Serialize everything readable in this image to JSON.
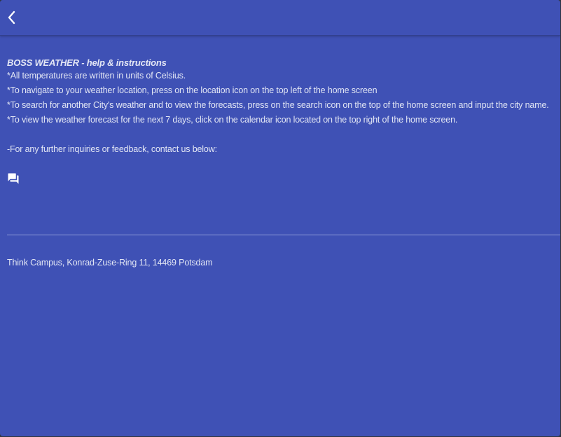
{
  "toolbar": {
    "back_icon": "chevron-left-icon"
  },
  "help": {
    "heading": "BOSS WEATHER - help & instructions",
    "lines": [
      "*All temperatures are written in units of Celsius.",
      "*To navigate to your weather location, press on the location icon on the top left of the home screen",
      "*To search for another City's weather and to view the forecasts, press on the search icon on the top of the home screen and input the city name.",
      "*To view the weather forecast for the next 7 days, click on the calendar icon located on the top right of the home screen."
    ],
    "contact_text": "-For any further inquiries or feedback, contact us below:",
    "contact_icon": "chat-icon"
  },
  "footer": {
    "address": "Think Campus, Konrad-Zuse-Ring 11, 14469 Potsdam"
  },
  "colors": {
    "background": "#3f51b5",
    "text": "#e2e6f4"
  }
}
